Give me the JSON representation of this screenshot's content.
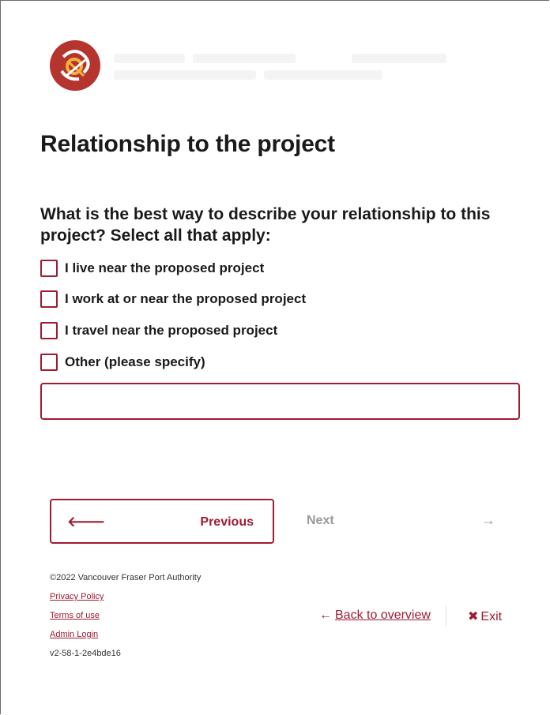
{
  "page": {
    "title": "Relationship to the project",
    "question": "What is the best way to describe your relationship to this project? Select all that apply:"
  },
  "options": [
    {
      "label": "I live near the proposed project",
      "checked": false
    },
    {
      "label": "I work at or near the proposed project",
      "checked": false
    },
    {
      "label": "I travel near the proposed project",
      "checked": false
    },
    {
      "label": "Other (please specify)",
      "checked": false
    }
  ],
  "other_input": {
    "value": "",
    "placeholder": ""
  },
  "nav": {
    "previous_label": "Previous",
    "previous_icon": "arrow-left-icon",
    "next_label": "Next",
    "next_icon": "arrow-right-icon"
  },
  "footer": {
    "copyright": "©2022 Vancouver Fraser Port Authority",
    "privacy": "Privacy Policy",
    "terms": "Terms of use",
    "admin": "Admin Login",
    "version": "v2-58-1-2e4bde16"
  },
  "actions": {
    "back_label": "Back to overview",
    "back_icon": "arrow-left-icon",
    "exit_label": "Exit",
    "exit_icon": "close-icon"
  },
  "colors": {
    "accent": "#9e1b32",
    "disabled": "#9a9a9a"
  }
}
